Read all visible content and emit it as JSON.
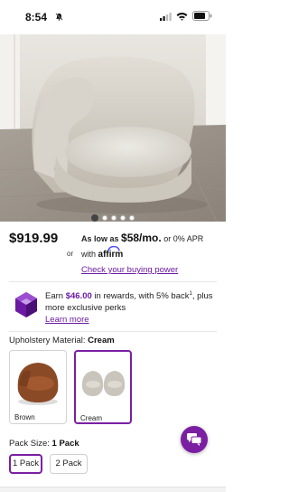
{
  "status_bar": {
    "time": "8:54",
    "icons": [
      "bell-slash-icon",
      "signal-icon",
      "wifi-icon",
      "battery-icon"
    ]
  },
  "gallery": {
    "image": "swivel-barrel-chair-photo",
    "slide_count": 5,
    "active_slide": 1
  },
  "pricing": {
    "price": "$919.99",
    "or_label": "or",
    "as_low_as_prefix": "As low as",
    "monthly_amount": "$58/mo.",
    "apr_suffix": "or 0% APR",
    "with_label": "with",
    "affirm_brand": "affirm",
    "check_link": "Check your buying power"
  },
  "rewards": {
    "prefix": "Earn",
    "amount": "$46.00",
    "middle": "in rewards, with 5% back",
    "footnote": "1",
    "tail": ", plus more exclusive perks",
    "learn_more": "Learn more"
  },
  "upholstery": {
    "label": "Upholstery Material:",
    "selected": "Cream",
    "options": [
      {
        "name": "Brown",
        "color": "#8a4a26",
        "selected": false
      },
      {
        "name": "Cream",
        "color": "#d9d5cd",
        "selected": true
      }
    ]
  },
  "pack_size": {
    "label": "Pack Size:",
    "selected": "1 Pack",
    "options": [
      {
        "name": "1 Pack",
        "selected": true
      },
      {
        "name": "2 Pack",
        "selected": false
      }
    ]
  },
  "chat": {
    "icon": "chat-bubble-icon"
  },
  "colors": {
    "accent": "#7b1fa2",
    "link": "#6a1aa3"
  }
}
